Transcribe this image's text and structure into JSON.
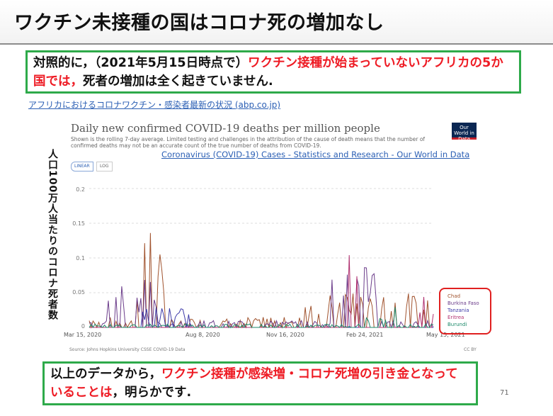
{
  "slide": {
    "title": "ワクチン未接種の国はコロナ死の増加なし",
    "box1_part1": "対照的に，（2021年5月15日時点で）",
    "box1_red": "ワクチン接種が始まっていないアフリカの5か国では，",
    "box1_part2": "死者の増加は全く起きていません.",
    "link_text": "アフリカにおけるコロナワクチン・感染者最新の状況 (abp.co.jp)",
    "ylabel": "人口100万人当たりのコロナ死者数",
    "box2_part1": "以上のデータから，",
    "box2_red": "ワクチン接種が感染増・コロナ死増の引き金となっていることは",
    "box2_part2": "，明らかです.",
    "page_number": "71"
  },
  "chart_data": {
    "type": "line",
    "title": "Daily new confirmed COVID-19 deaths per million people",
    "subtitle": "Shown is the rolling 7-day average. Limited testing and challenges in the attribution of the cause of death means that the number of confirmed deaths may not be an accurate count of the true number of deaths from COVID-19.",
    "link": "Coronavirus (COVID-19) Cases - Statistics and Research - Our World in Data",
    "logo": "Our World in Data",
    "toggle": [
      "LINEAR",
      "LOG"
    ],
    "x_ticks": [
      "Mar 15, 2020",
      "Aug 8, 2020",
      "Nov 16, 2020",
      "Feb 24, 2021",
      "May 15, 2021"
    ],
    "y_ticks": [
      "0",
      "0.05",
      "0.1",
      "0.15",
      "0.2"
    ],
    "ylim": [
      0,
      0.22
    ],
    "source": "Source: Johns Hopkins University CSSE COVID-19 Data",
    "license": "CC BY",
    "legend_position": "bottom-right",
    "series": [
      {
        "name": "Chad",
        "color": "#a0522d"
      },
      {
        "name": "Burkina Faso",
        "color": "#6b3c8a"
      },
      {
        "name": "Tanzania",
        "color": "#3d3aa8"
      },
      {
        "name": "Eritrea",
        "color": "#b0306f"
      },
      {
        "name": "Burundi",
        "color": "#1d8a6a"
      }
    ]
  }
}
